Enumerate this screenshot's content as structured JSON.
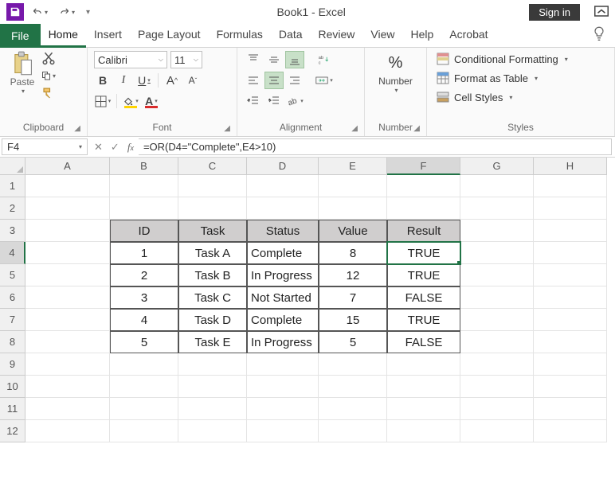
{
  "titlebar": {
    "title": "Book1  -  Excel",
    "signin": "Sign in"
  },
  "tabs": {
    "file": "File",
    "items": [
      "Home",
      "Insert",
      "Page Layout",
      "Formulas",
      "Data",
      "Review",
      "View",
      "Help",
      "Acrobat"
    ],
    "active": 0
  },
  "clipboard": {
    "paste": "Paste",
    "label": "Clipboard"
  },
  "font": {
    "name": "Calibri",
    "size": "11",
    "label": "Font"
  },
  "alignment": {
    "label": "Alignment"
  },
  "number": {
    "label": "Number",
    "btn": "Number"
  },
  "styles": {
    "cond": "Conditional Formatting",
    "table": "Format as Table",
    "cell": "Cell Styles",
    "label": "Styles"
  },
  "formula_bar": {
    "cell_ref": "F4",
    "formula": "=OR(D4=\"Complete\",E4>10)"
  },
  "grid": {
    "cols": [
      "A",
      "B",
      "C",
      "D",
      "E",
      "F",
      "G",
      "H"
    ],
    "row_count": 12,
    "active_col": "F",
    "active_row": 4,
    "headers": {
      "B": "ID",
      "C": "Task",
      "D": "Status",
      "E": "Value",
      "F": "Result"
    },
    "data": [
      {
        "B": "1",
        "C": "Task A",
        "D": "Complete",
        "E": "8",
        "F": "TRUE"
      },
      {
        "B": "2",
        "C": "Task B",
        "D": "In Progress",
        "E": "12",
        "F": "TRUE"
      },
      {
        "B": "3",
        "C": "Task C",
        "D": "Not Started",
        "E": "7",
        "F": "FALSE"
      },
      {
        "B": "4",
        "C": "Task D",
        "D": "Complete",
        "E": "15",
        "F": "TRUE"
      },
      {
        "B": "5",
        "C": "Task E",
        "D": "In Progress",
        "E": "5",
        "F": "FALSE"
      }
    ]
  },
  "chart_data": {
    "type": "table",
    "title": "",
    "columns": [
      "ID",
      "Task",
      "Status",
      "Value",
      "Result"
    ],
    "rows": [
      [
        1,
        "Task A",
        "Complete",
        8,
        "TRUE"
      ],
      [
        2,
        "Task B",
        "In Progress",
        12,
        "TRUE"
      ],
      [
        3,
        "Task C",
        "Not Started",
        7,
        "FALSE"
      ],
      [
        4,
        "Task D",
        "Complete",
        15,
        "TRUE"
      ],
      [
        5,
        "Task E",
        "In Progress",
        5,
        "FALSE"
      ]
    ]
  }
}
